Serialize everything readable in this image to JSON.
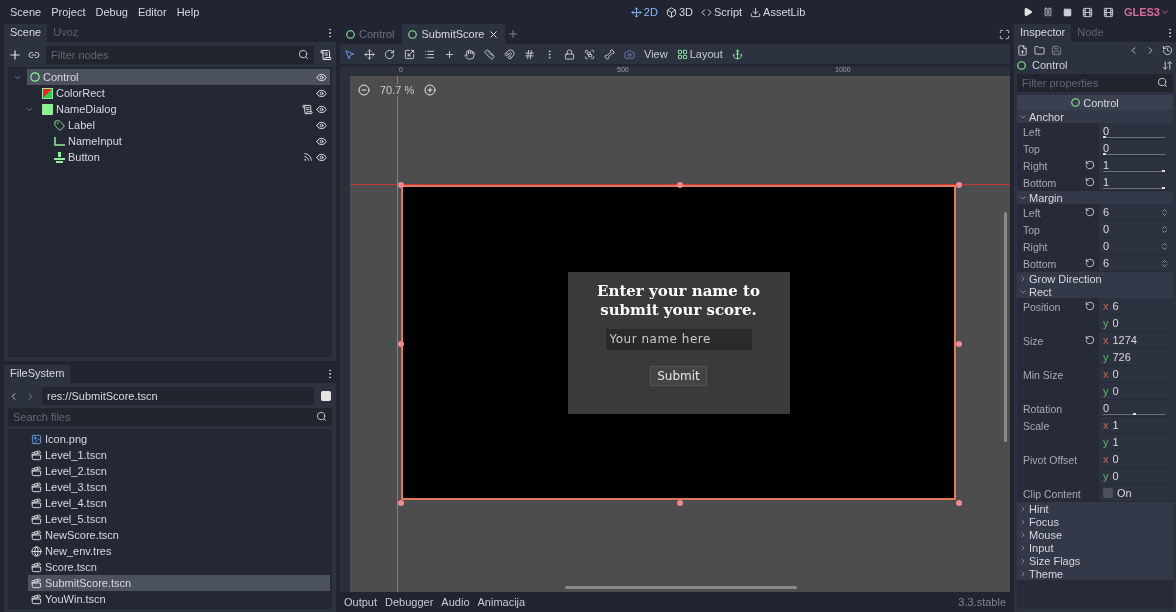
{
  "menu": [
    "Scene",
    "Project",
    "Debug",
    "Editor",
    "Help"
  ],
  "workspaces": [
    {
      "label": "2D",
      "kind": "canvas",
      "selected": true
    },
    {
      "label": "3D",
      "kind": "spatial",
      "selected": false
    },
    {
      "label": "Script",
      "kind": "script",
      "selected": false
    },
    {
      "label": "AssetLib",
      "kind": "assetlib",
      "selected": false
    }
  ],
  "renderer": "GLES3",
  "scene_dock": {
    "tabs": [
      {
        "label": "Scene",
        "selected": true
      },
      {
        "label": "Uvoz",
        "selected": false
      }
    ],
    "filter": {
      "placeholder": "Filter nodes"
    },
    "tree": [
      {
        "name": "Control",
        "kind": "control",
        "selected": true,
        "expanded": true,
        "script": false,
        "signals": false,
        "children": [
          {
            "name": "ColorRect",
            "kind": "colorrect",
            "selected": false,
            "script": false,
            "signals": false
          },
          {
            "name": "NameDialog",
            "kind": "panel",
            "selected": false,
            "expanded": true,
            "script": true,
            "signals": false,
            "children": [
              {
                "name": "Label",
                "kind": "label",
                "selected": false,
                "script": false,
                "signals": false
              },
              {
                "name": "NameInput",
                "kind": "lineedit",
                "selected": false,
                "script": false,
                "signals": false
              },
              {
                "name": "Button",
                "kind": "button",
                "selected": false,
                "script": false,
                "signals": true
              }
            ]
          }
        ]
      }
    ]
  },
  "filesystem": {
    "tab": "FileSystem",
    "path": "res://SubmitScore.tscn",
    "search": {
      "placeholder": "Search files"
    },
    "files": [
      {
        "name": "Icon.png",
        "kind": "image",
        "selected": false
      },
      {
        "name": "Level_1.tscn",
        "kind": "scene",
        "selected": false
      },
      {
        "name": "Level_2.tscn",
        "kind": "scene",
        "selected": false
      },
      {
        "name": "Level_3.tscn",
        "kind": "scene",
        "selected": false
      },
      {
        "name": "Level_4.tscn",
        "kind": "scene",
        "selected": false
      },
      {
        "name": "Level_5.tscn",
        "kind": "scene",
        "selected": false
      },
      {
        "name": "NewScore.tscn",
        "kind": "scene",
        "selected": false
      },
      {
        "name": "New_env.tres",
        "kind": "resource",
        "selected": false
      },
      {
        "name": "Score.tscn",
        "kind": "scene",
        "selected": false
      },
      {
        "name": "SubmitScore.tscn",
        "kind": "scene",
        "selected": true
      },
      {
        "name": "YouWin.tscn",
        "kind": "scene",
        "selected": false
      }
    ]
  },
  "editor": {
    "tabs": [
      {
        "label": "Control",
        "selected": false
      },
      {
        "label": "SubmitScore",
        "selected": true
      }
    ],
    "toolbar": {
      "view": "View",
      "layout": "Layout"
    },
    "zoom": "70.7 %",
    "ruler": [
      "0",
      "500",
      "1000"
    ],
    "dialog": {
      "title": "Enter your name to submit your score.",
      "input": {
        "placeholder": "Your name here"
      },
      "button": "Submit"
    }
  },
  "bottom_panel": {
    "tabs": [
      "Output",
      "Debugger",
      "Audio",
      "Animacija"
    ],
    "version": "3.3.stable"
  },
  "inspector": {
    "tabs": [
      {
        "label": "Inspector",
        "selected": true
      },
      {
        "label": "Node",
        "selected": false
      }
    ],
    "node": "Control",
    "filter": {
      "placeholder": "Filter properties"
    },
    "class": "Control",
    "rows": [
      {
        "kind": "section",
        "label": "Anchor",
        "expanded": true
      },
      {
        "kind": "slider",
        "label": "Left",
        "value": "0",
        "level": 0,
        "revert": false
      },
      {
        "kind": "slider",
        "label": "Top",
        "value": "0",
        "level": 0,
        "revert": false
      },
      {
        "kind": "slider",
        "label": "Right",
        "value": "1",
        "level": 1,
        "revert": true
      },
      {
        "kind": "slider",
        "label": "Bottom",
        "value": "1",
        "level": 1,
        "revert": true
      },
      {
        "kind": "section",
        "label": "Margin",
        "expanded": true
      },
      {
        "kind": "spin",
        "label": "Left",
        "value": "6",
        "revert": true
      },
      {
        "kind": "spin",
        "label": "Top",
        "value": "0",
        "revert": false
      },
      {
        "kind": "spin",
        "label": "Right",
        "value": "0",
        "revert": false
      },
      {
        "kind": "spin",
        "label": "Bottom",
        "value": "6",
        "revert": true
      },
      {
        "kind": "section",
        "label": "Grow Direction",
        "expanded": false
      },
      {
        "kind": "section",
        "label": "Rect",
        "expanded": true
      },
      {
        "kind": "vector",
        "label": "Position",
        "components": [
          {
            "axis": "x",
            "value": "6"
          },
          {
            "axis": "y",
            "value": "0"
          }
        ],
        "revert": true
      },
      {
        "kind": "vector",
        "label": "Size",
        "components": [
          {
            "axis": "x",
            "value": "1274"
          },
          {
            "axis": "y",
            "value": "726"
          }
        ],
        "revert": true
      },
      {
        "kind": "vector",
        "label": "Min Size",
        "components": [
          {
            "axis": "x",
            "value": "0"
          },
          {
            "axis": "y",
            "value": "0"
          }
        ],
        "revert": false
      },
      {
        "kind": "slider",
        "label": "Rotation",
        "value": "0",
        "level": 0.5,
        "revert": false
      },
      {
        "kind": "vector",
        "label": "Scale",
        "components": [
          {
            "axis": "x",
            "value": "1"
          },
          {
            "axis": "y",
            "value": "1"
          }
        ],
        "revert": false
      },
      {
        "kind": "vector",
        "label": "Pivot Offset",
        "components": [
          {
            "axis": "x",
            "value": "0"
          },
          {
            "axis": "y",
            "value": "0"
          }
        ],
        "revert": false
      },
      {
        "kind": "check",
        "label": "Clip Content",
        "text": "On",
        "checked": false
      },
      {
        "kind": "section",
        "label": "Hint",
        "expanded": false
      },
      {
        "kind": "section",
        "label": "Focus",
        "expanded": false
      },
      {
        "kind": "section",
        "label": "Mouse",
        "expanded": false
      },
      {
        "kind": "section",
        "label": "Input",
        "expanded": false
      },
      {
        "kind": "section",
        "label": "Size Flags",
        "expanded": false
      },
      {
        "kind": "section",
        "label": "Theme",
        "expanded": false
      }
    ]
  }
}
